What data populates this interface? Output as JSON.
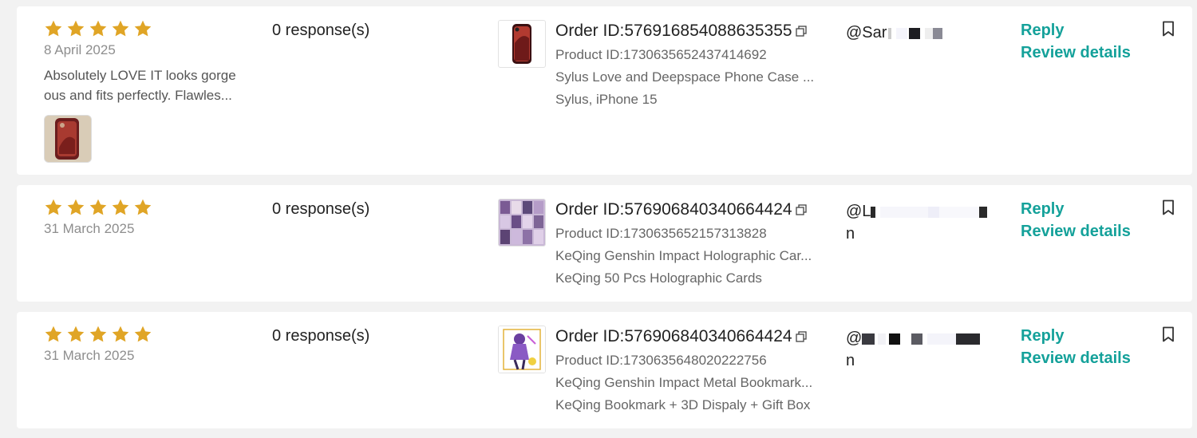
{
  "reviews": [
    {
      "rating": 5,
      "date": "8 April 2025",
      "text": "Absolutely LOVE IT looks gorge ous and fits perfectly. Flawles...",
      "responses": "0 response(s)",
      "order_id": "Order ID:576916854088635355",
      "product_id": "Product ID:1730635652437414692",
      "product_name": "Sylus Love and Deepspace Phone Case ...",
      "variant": "Sylus, iPhone 15",
      "user_line1": "@Sar",
      "user_line2": "",
      "reply": "Reply",
      "details": "Review details"
    },
    {
      "rating": 5,
      "date": "31 March 2025",
      "text": "",
      "responses": "0 response(s)",
      "order_id": "Order ID:576906840340664424",
      "product_id": "Product ID:1730635652157313828",
      "product_name": "KeQing Genshin Impact Holographic Car...",
      "variant": "KeQing 50 Pcs Holographic Cards",
      "user_line1": "@L",
      "user_line2": "n",
      "reply": "Reply",
      "details": "Review details"
    },
    {
      "rating": 5,
      "date": "31 March 2025",
      "text": "",
      "responses": "0 response(s)",
      "order_id": "Order ID:576906840340664424",
      "product_id": "Product ID:1730635648020222756",
      "product_name": "KeQing Genshin Impact Metal Bookmark...",
      "variant": "KeQing Bookmark + 3D Dispaly + Gift Box",
      "user_line1": "@",
      "user_line2": "n",
      "reply": "Reply",
      "details": "Review details"
    }
  ],
  "colors": {
    "star": "#e0a526",
    "accent": "#14a19a",
    "muted": "#8e8e8e"
  },
  "icons": [
    "star-icon",
    "copy-icon",
    "bookmark-icon"
  ]
}
